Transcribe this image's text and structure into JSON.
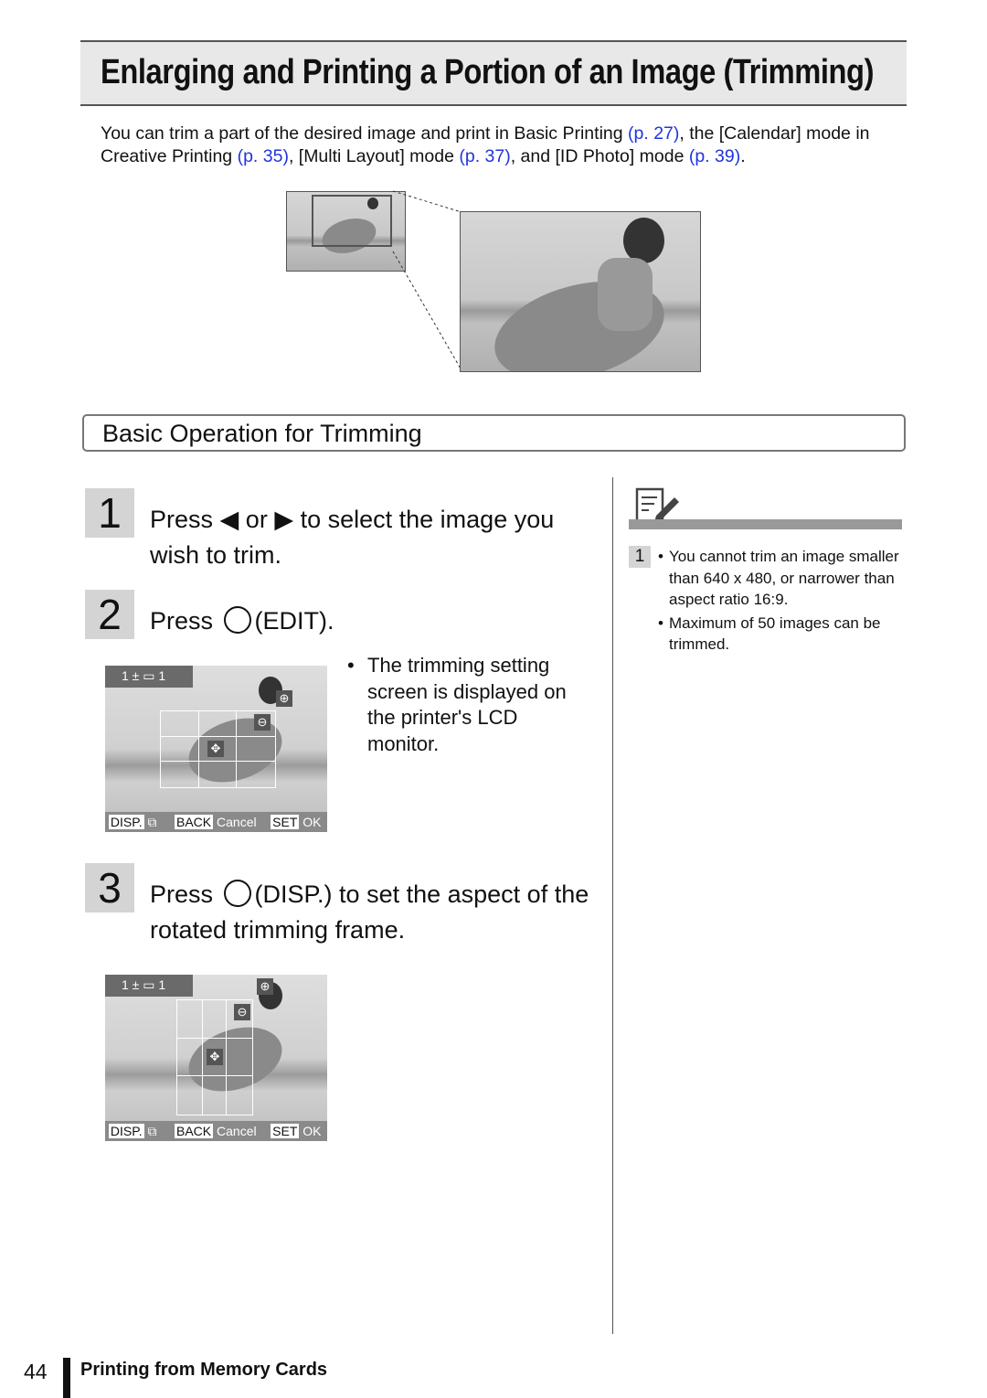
{
  "title": "Enlarging and Printing a Portion of an Image (Trimming)",
  "intro": {
    "t1": "You can trim a part of the desired image and print in Basic Printing ",
    "l1": "(p. 27)",
    "t2": ", the [Calendar] mode in Creative Printing ",
    "l2": "(p. 35)",
    "t3": ", [Multi Layout] mode ",
    "l3": "(p. 37)",
    "t4": ", and [ID Photo] mode ",
    "l4": "(p. 39)",
    "t5": "."
  },
  "section": "Basic Operation for Trimming",
  "steps": [
    {
      "num": "1",
      "a": "Press ",
      "b": " or ",
      "c": " to select the image you wish to trim."
    },
    {
      "num": "2",
      "a": "Press ",
      "b": "(EDIT)."
    },
    {
      "num": "3",
      "a": "Press ",
      "b": "(DISP.) to set the aspect of the rotated trimming frame."
    }
  ],
  "bullet": "The trimming setting screen is displayed on the printer's LCD monitor.",
  "lcd": {
    "count": "1",
    "copies": "1",
    "disp": "DISP.",
    "back": "BACK",
    "cancel": "Cancel",
    "set": "SET",
    "ok": "OK"
  },
  "note": {
    "num": "1",
    "items": [
      "You cannot trim an image smaller than 640 x 480, or narrower than aspect ratio 16:9.",
      "Maximum of 50 images can be trimmed."
    ]
  },
  "footer": {
    "page": "44",
    "chapter": "Printing from Memory Cards"
  }
}
